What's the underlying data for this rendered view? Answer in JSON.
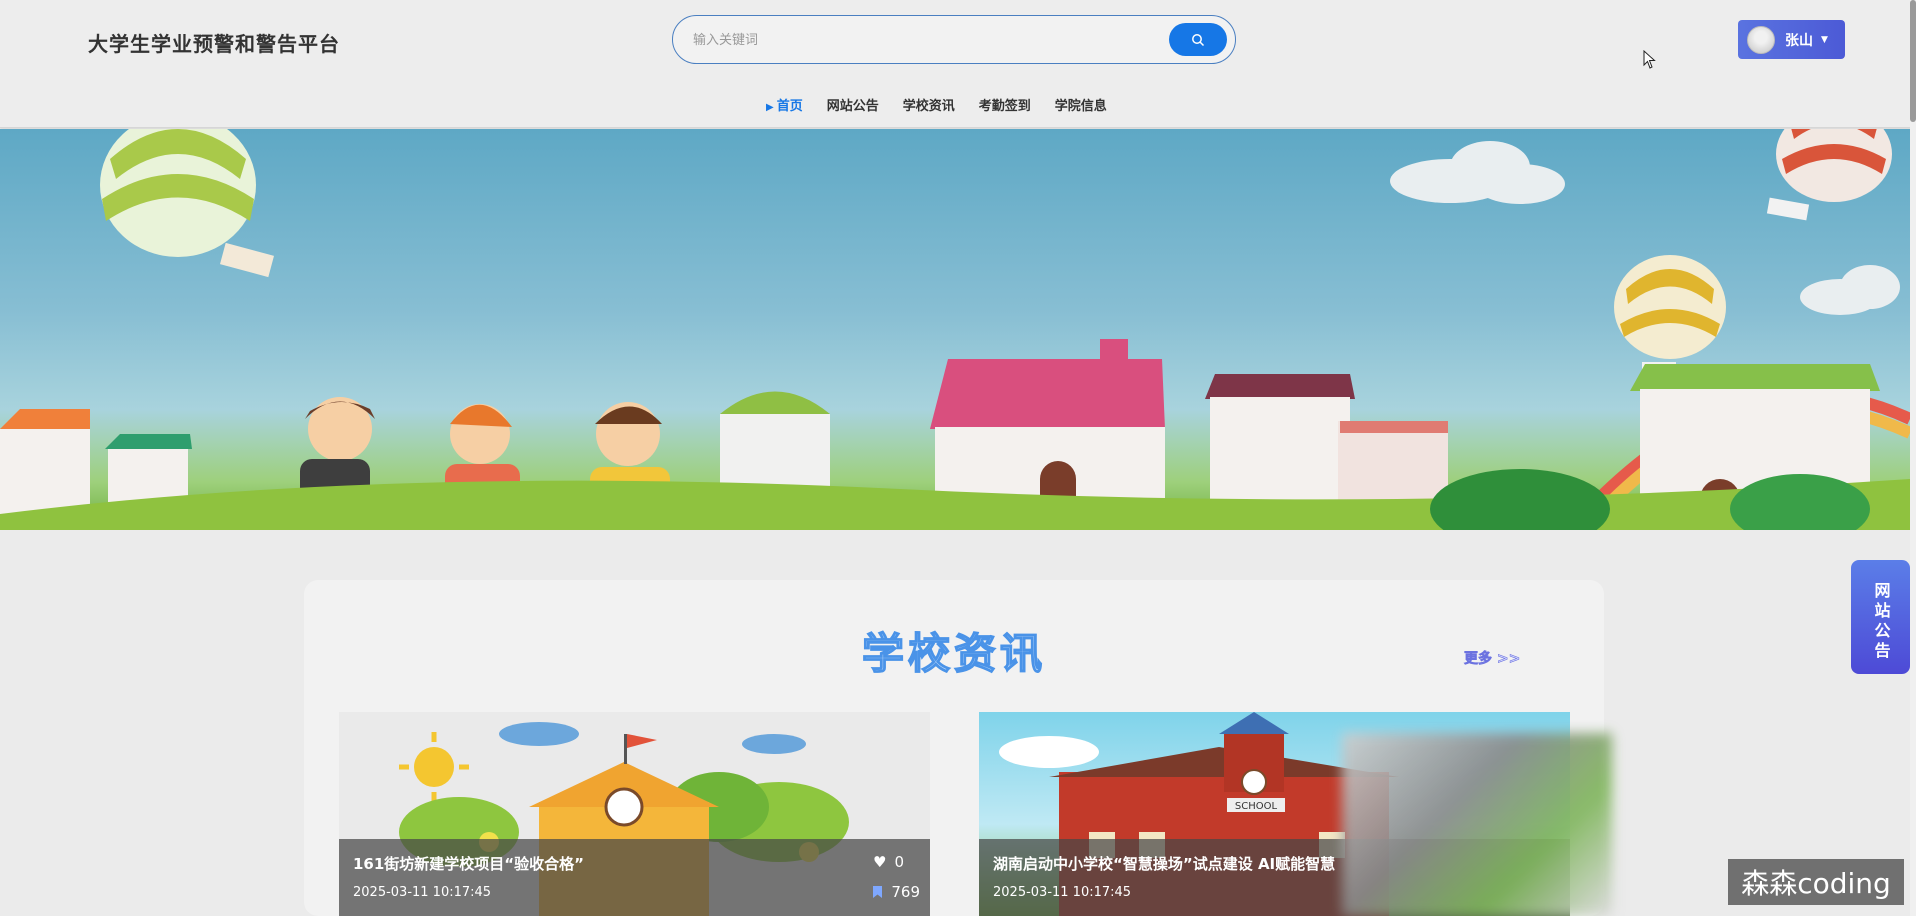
{
  "header": {
    "site_title": "大学生学业预警和警告平台",
    "search": {
      "placeholder": "输入关键词",
      "value": ""
    },
    "user": {
      "name": "张山"
    }
  },
  "nav": {
    "items": [
      {
        "label": "首页",
        "active": true
      },
      {
        "label": "网站公告",
        "active": false
      },
      {
        "label": "学校资讯",
        "active": false
      },
      {
        "label": "考勤签到",
        "active": false
      },
      {
        "label": "学院信息",
        "active": false
      }
    ]
  },
  "section": {
    "title": "学校资讯",
    "more_label": "更多 >>"
  },
  "news": [
    {
      "title": "161街坊新建学校项目“验收合格”",
      "date": "2025-03-11 10:17:45",
      "likes": "0",
      "views": "769"
    },
    {
      "title": "湖南启动中小学校“智慧操场”试点建设 AI赋能智慧",
      "date": "2025-03-11 10:17:45"
    }
  ],
  "float_notice": {
    "label": "网站公告"
  },
  "watermark": "森森coding",
  "colors": {
    "accent": "#1677e6",
    "user_button": "#5068dc",
    "notice_button": "#4d4ad6"
  }
}
